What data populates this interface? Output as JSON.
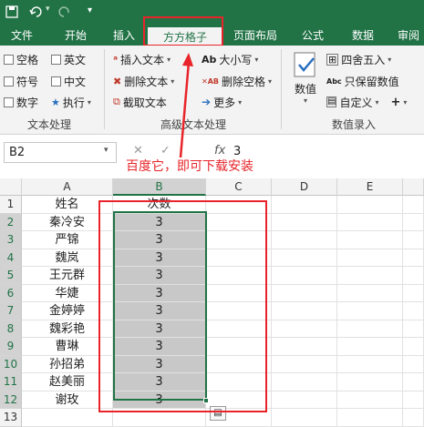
{
  "quick_access": {
    "save_icon": "save-icon",
    "undo_icon": "undo-icon",
    "redo_icon": "redo-icon",
    "customize_icon": "chevron-down-icon"
  },
  "tabs": [
    "文件",
    "开始",
    "插入",
    "方方格子",
    "页面布局",
    "公式",
    "数据",
    "审阅"
  ],
  "active_tab": "方方格子",
  "ribbon": {
    "text_processing": {
      "label": "文本处理",
      "items": [
        "空格",
        "英文",
        "符号",
        "中文",
        "数字",
        "执行"
      ]
    },
    "advanced_text": {
      "label": "高级文本处理",
      "insert_text": "插入文本",
      "delete_text": "删除文本",
      "extract_text": "截取文本",
      "case": "大小写",
      "delete_space": "删除空格",
      "more": "更多"
    },
    "numeric": {
      "label": "数值录入",
      "value_btn": "数值",
      "round": "四舍五入",
      "keep_value": "只保留数值",
      "custom": "自定义"
    }
  },
  "formula_bar": {
    "name_box": "B2",
    "fx": "fx",
    "value": "3"
  },
  "annotation": "百度它，即可下载安装",
  "columns": [
    "A",
    "B",
    "C",
    "D",
    "E"
  ],
  "rows": [
    {
      "n": "1",
      "a": "姓名",
      "b": "次数"
    },
    {
      "n": "2",
      "a": "秦冷安",
      "b": "3"
    },
    {
      "n": "3",
      "a": "严锦",
      "b": "3"
    },
    {
      "n": "4",
      "a": "魏岚",
      "b": "3"
    },
    {
      "n": "5",
      "a": "王元群",
      "b": "3"
    },
    {
      "n": "6",
      "a": "华婕",
      "b": "3"
    },
    {
      "n": "7",
      "a": "金婷婷",
      "b": "3"
    },
    {
      "n": "8",
      "a": "魏彩艳",
      "b": "3"
    },
    {
      "n": "9",
      "a": "曹琳",
      "b": "3"
    },
    {
      "n": "10",
      "a": "孙招弟",
      "b": "3"
    },
    {
      "n": "11",
      "a": "赵美丽",
      "b": "3"
    },
    {
      "n": "12",
      "a": "谢玫",
      "b": "3"
    },
    {
      "n": "13",
      "a": "",
      "b": ""
    }
  ],
  "colors": {
    "excel_green": "#217346",
    "highlight_red": "#e8242a",
    "selection_gray": "#c8c8c8"
  }
}
